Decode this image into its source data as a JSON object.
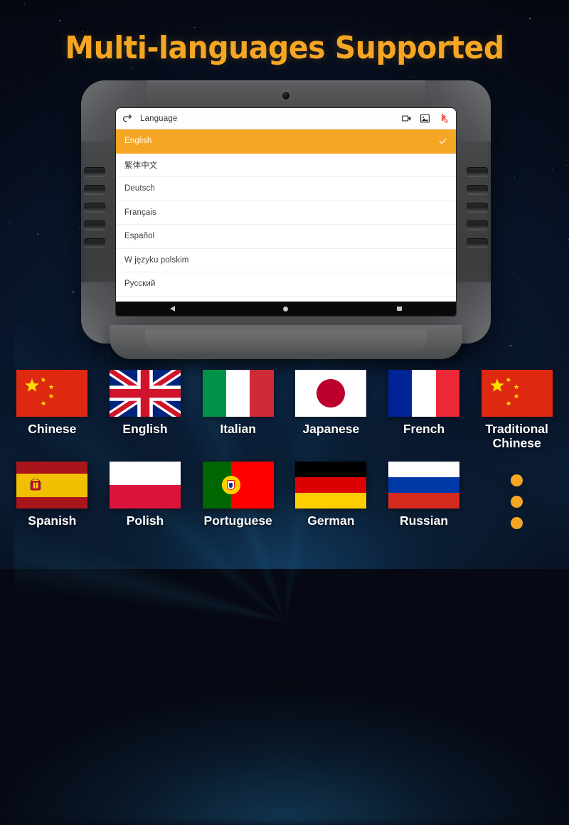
{
  "page": {
    "title": "Multi-languages Supported",
    "accent_orange": "#F5A623",
    "background": "dark-space-navy"
  },
  "device": {
    "type": "rugged-tablet-diagnostic-scanner",
    "camera": "front-camera"
  },
  "screen": {
    "appbar": {
      "back_icon": "back-arrow-icon",
      "title": "Language",
      "icons": [
        {
          "name": "video-record-icon",
          "color": "#333333"
        },
        {
          "name": "screenshot-image-icon",
          "color": "#333333"
        },
        {
          "name": "bluetooth-icon",
          "color": "#E8412A"
        }
      ]
    },
    "language_list": [
      {
        "label": "English",
        "selected": true
      },
      {
        "label": "繁体中文",
        "selected": false
      },
      {
        "label": "Deutsch",
        "selected": false
      },
      {
        "label": "Français",
        "selected": false
      },
      {
        "label": "Español",
        "selected": false
      },
      {
        "label": "W języku polskim",
        "selected": false
      },
      {
        "label": "Русский",
        "selected": false
      }
    ],
    "selected_check_icon": "checkmark-icon",
    "navbar": [
      {
        "name": "android-back-button"
      },
      {
        "name": "android-home-button"
      },
      {
        "name": "android-recents-button"
      }
    ]
  },
  "flags": [
    {
      "label": "Chinese",
      "flag": "flag-china"
    },
    {
      "label": "English",
      "flag": "flag-united-kingdom"
    },
    {
      "label": "Italian",
      "flag": "flag-italy"
    },
    {
      "label": "Japanese",
      "flag": "flag-japan"
    },
    {
      "label": "French",
      "flag": "flag-france"
    },
    {
      "label": "Traditional\nChinese",
      "flag": "flag-china"
    },
    {
      "label": "Spanish",
      "flag": "flag-spain"
    },
    {
      "label": "Polish",
      "flag": "flag-poland"
    },
    {
      "label": "Portuguese",
      "flag": "flag-portugal"
    },
    {
      "label": "German",
      "flag": "flag-germany"
    },
    {
      "label": "Russian",
      "flag": "flag-russia"
    }
  ],
  "more_indicator": {
    "name": "more-languages-dots",
    "count": 3,
    "color": "#F5A623"
  }
}
